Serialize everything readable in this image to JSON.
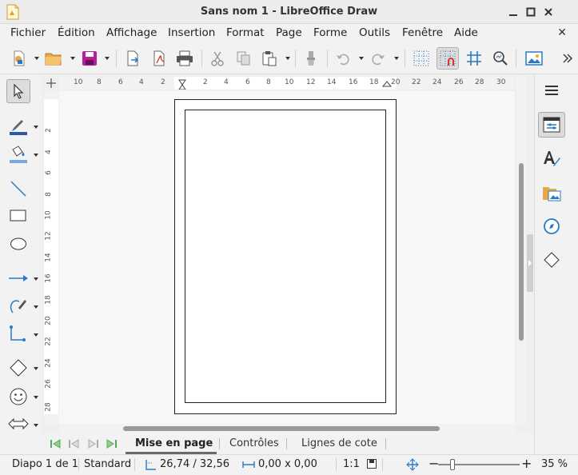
{
  "window": {
    "title": "Sans nom 1 - LibreOffice Draw"
  },
  "menu": [
    "Fichier",
    "Édition",
    "Affichage",
    "Insertion",
    "Format",
    "Page",
    "Forme",
    "Outils",
    "Fenêtre",
    "Aide"
  ],
  "hruler": [
    "10",
    "8",
    "6",
    "4",
    "2",
    "2",
    "4",
    "6",
    "8",
    "10",
    "12",
    "14",
    "16",
    "18",
    "20",
    "22",
    "24",
    "26",
    "28",
    "30"
  ],
  "vruler": [
    "2",
    "4",
    "6",
    "8",
    "10",
    "12",
    "14",
    "16",
    "18",
    "20",
    "22",
    "24",
    "26",
    "28"
  ],
  "tabs": [
    "Mise en page",
    "Contrôles",
    "Lignes de cote"
  ],
  "status": {
    "slide": "Diapo 1 de 1",
    "master": "Standard",
    "position": "26,74 / 32,56",
    "size": "0,00 x 0,00",
    "scale": "1:1",
    "zoom": "35 %"
  },
  "zoom_fraction": 0.35
}
